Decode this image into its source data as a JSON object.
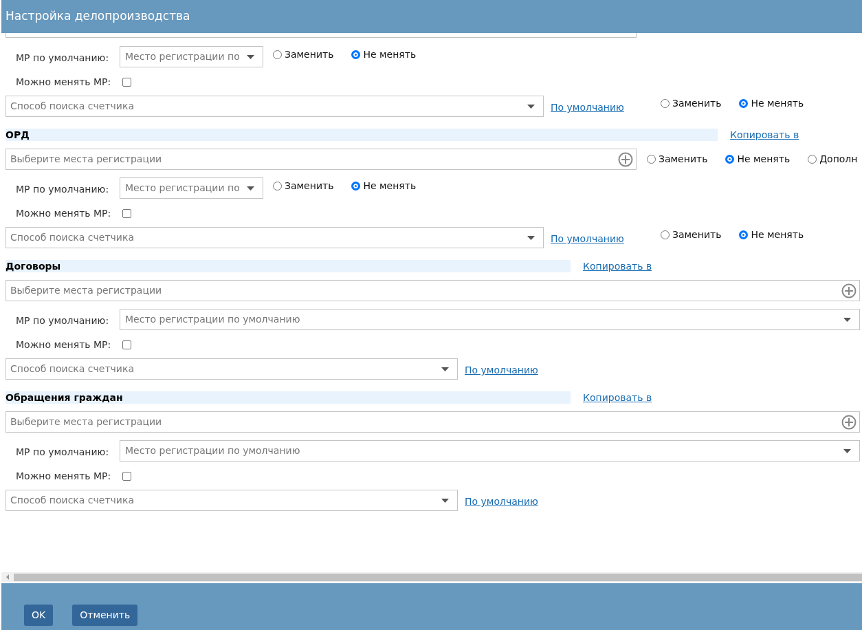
{
  "window": {
    "title": "Настройка делопроизводства"
  },
  "sections": [
    {
      "registration": {
        "cut_off": true
      },
      "default_place": {
        "label": "МР по умолчанию:",
        "value": "Место регистрации по",
        "radios": [
          {
            "label": "Заменить",
            "selected": false
          },
          {
            "label": "Не менять",
            "selected": true
          }
        ]
      },
      "can_change": {
        "label": "Можно менять МР:",
        "checked": false
      },
      "counter": {
        "placeholder": "Способ поиска счетчика",
        "link": "По умолчанию",
        "radios": [
          {
            "label": "Заменить",
            "selected": false
          },
          {
            "label": "Не менять",
            "selected": true
          }
        ]
      }
    },
    {
      "title": "ОРД",
      "copy_link": "Копировать в",
      "registration": {
        "placeholder": "Выберите места регистрации",
        "radios": [
          {
            "label": "Заменить",
            "selected": false
          },
          {
            "label": "Не менять",
            "selected": true
          },
          {
            "label": "Дополн",
            "selected": false
          }
        ]
      },
      "default_place": {
        "label": "МР по умолчанию:",
        "value": "Место регистрации по",
        "radios": [
          {
            "label": "Заменить",
            "selected": false
          },
          {
            "label": "Не менять",
            "selected": true
          }
        ]
      },
      "can_change": {
        "label": "Можно менять МР:",
        "checked": false
      },
      "counter": {
        "placeholder": "Способ поиска счетчика",
        "link": "По умолчанию",
        "radios": [
          {
            "label": "Заменить",
            "selected": false
          },
          {
            "label": "Не менять",
            "selected": true
          }
        ]
      }
    },
    {
      "title": "Договоры",
      "copy_link": "Копировать в",
      "registration": {
        "placeholder": "Выберите места регистрации"
      },
      "default_place": {
        "label": "МР по умолчанию:",
        "value": "Место регистрации по умолчанию"
      },
      "can_change": {
        "label": "Можно менять МР:",
        "checked": false
      },
      "counter": {
        "placeholder": "Способ поиска счетчика",
        "link": "По умолчанию"
      }
    },
    {
      "title": "Обращения граждан",
      "copy_link": "Копировать в",
      "registration": {
        "placeholder": "Выберите места регистрации"
      },
      "default_place": {
        "label": "МР по умолчанию:",
        "value": "Место регистрации по умолчанию"
      },
      "can_change": {
        "label": "Можно менять МР:",
        "checked": false
      },
      "counter": {
        "placeholder": "Способ поиска счетчика",
        "link": "По умолчанию"
      }
    }
  ],
  "buttons": [
    {
      "label": "OK"
    },
    {
      "label": "Отменить"
    }
  ]
}
